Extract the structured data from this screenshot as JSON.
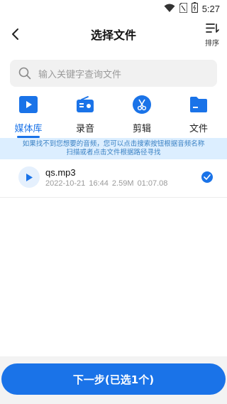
{
  "status": {
    "time": "5:27"
  },
  "header": {
    "title": "选择文件",
    "sort_label": "排序"
  },
  "search": {
    "placeholder": "输入关键字查询文件"
  },
  "tabs": [
    {
      "label": "媒体库",
      "icon": "media-library-icon",
      "active": true
    },
    {
      "label": "录音",
      "icon": "radio-recorder-icon",
      "active": false
    },
    {
      "label": "剪辑",
      "icon": "scissors-icon",
      "active": false
    },
    {
      "label": "文件",
      "icon": "folder-icon",
      "active": false
    }
  ],
  "notice": "如果找不到您想要的音频，您可以点击搜索按钮根据音频名称扫描或者点击文件根据路径寻找",
  "files": [
    {
      "name": "qs.mp3",
      "date": "2022-10-21 16:44",
      "size": "2.59M",
      "duration": "01:07.08",
      "selected": true
    }
  ],
  "footer": {
    "next_label": "下一步(已选1个)"
  },
  "colors": {
    "accent": "#1a73e8",
    "notice_bg": "#dceeff"
  }
}
